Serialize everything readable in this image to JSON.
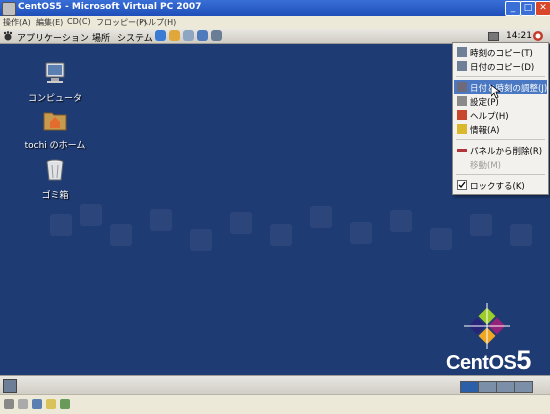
{
  "window": {
    "title": "CentOS5 - Microsoft Virtual PC 2007"
  },
  "vpc_menu": [
    {
      "id": "action",
      "label": "操作(A)"
    },
    {
      "id": "edit",
      "label": "編集(E)"
    },
    {
      "id": "cd",
      "label": "CD(C)"
    },
    {
      "id": "floppy",
      "label": "フロッピー(F)"
    },
    {
      "id": "help",
      "label": "ヘルプ(H)"
    }
  ],
  "gnome_panel": {
    "menus": [
      {
        "id": "applications",
        "label": "アプリケーション"
      },
      {
        "id": "places",
        "label": "場所"
      },
      {
        "id": "system",
        "label": "システム"
      }
    ],
    "launchers": [
      {
        "name": "web-browser-icon",
        "color": "#3b7bd4"
      },
      {
        "name": "email-icon",
        "color": "#e0a83a"
      },
      {
        "name": "text-editor-icon",
        "color": "#8fa6c2"
      },
      {
        "name": "notes-icon",
        "color": "#4f7bbd"
      }
    ],
    "clock": "14:21"
  },
  "desktop_icons": [
    {
      "id": "computer",
      "label": "コンピュータ",
      "icon": "computer-icon"
    },
    {
      "id": "home",
      "label": "tochi のホーム",
      "icon": "home-folder-icon"
    },
    {
      "id": "trash",
      "label": "ゴミ箱",
      "icon": "trash-icon"
    }
  ],
  "context_menu": {
    "items": [
      {
        "id": "copy-time",
        "label": "時刻のコピー(T)",
        "icon": "copy-icon",
        "color": "#6f7f98"
      },
      {
        "id": "copy-date",
        "label": "日付のコピー(D)",
        "icon": "copy-icon",
        "color": "#6f7f98"
      },
      {
        "id": "adjust-datetime",
        "label": "日付と時刻の調整(J)",
        "icon": "clock-settings-icon",
        "color": "#6e6a7a",
        "highlighted": true
      },
      {
        "id": "preferences",
        "label": "設定(P)",
        "icon": "wrench-icon",
        "color": "#8a8a8a"
      },
      {
        "id": "help",
        "label": "ヘルプ(H)",
        "icon": "help-icon",
        "color": "#c8452e"
      },
      {
        "id": "about",
        "label": "情報(A)",
        "icon": "star-icon",
        "color": "#d9b82e"
      },
      {
        "id": "remove-from-panel",
        "label": "パネルから削除(R)",
        "icon": "remove-icon",
        "color": "#b3343a"
      },
      {
        "id": "move",
        "label": "移動(M)",
        "disabled": true
      },
      {
        "id": "lock",
        "label": "ロックする(K)",
        "checkbox": true,
        "checked": true
      }
    ]
  },
  "branding": {
    "text": "CentOS",
    "version": "5"
  }
}
